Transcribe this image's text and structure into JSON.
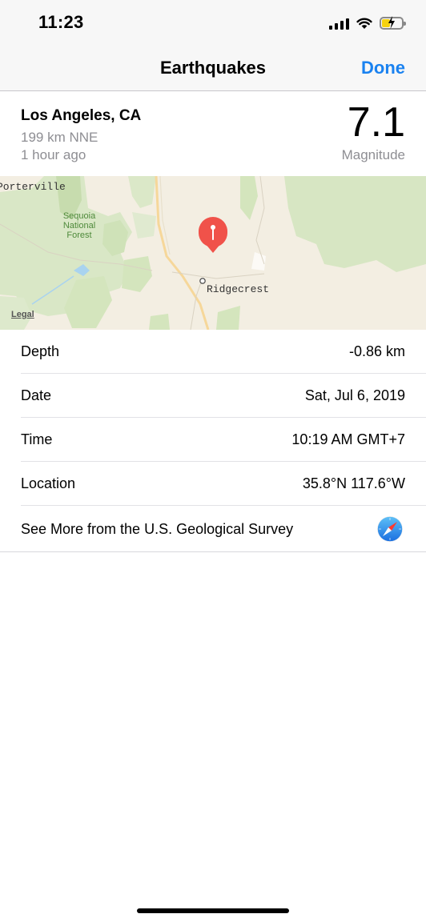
{
  "status_bar": {
    "time": "11:23",
    "signal_icon": "cellular-signal-icon",
    "wifi_icon": "wifi-icon",
    "battery_icon": "battery-charging-icon",
    "battery_color": "#f5d20e"
  },
  "nav": {
    "title": "Earthquakes",
    "done_label": "Done",
    "accent_color": "#1a82f0"
  },
  "summary": {
    "place": "Los Angeles, CA",
    "distance": "199 km NNE",
    "time_ago": "1 hour ago",
    "magnitude": "7.1",
    "magnitude_label": "Magnitude"
  },
  "map": {
    "labels": {
      "porterville": "Porterville",
      "sequoia_1": "Sequoia",
      "sequoia_2": "National",
      "sequoia_3": "Forest",
      "ridgecrest": "Ridgecrest"
    },
    "legal": "Legal",
    "pin_icon": "map-pin-icon",
    "pin_color": "#f0524a"
  },
  "details": {
    "depth_label": "Depth",
    "depth_value": "-0.86 km",
    "date_label": "Date",
    "date_value": "Sat, Jul 6, 2019",
    "time_label": "Time",
    "time_value": "10:19 AM GMT+7",
    "location_label": "Location",
    "location_value": "35.8°N 117.6°W",
    "see_more_label": "See More from the U.S. Geological Survey",
    "see_more_icon": "safari-compass-icon"
  }
}
